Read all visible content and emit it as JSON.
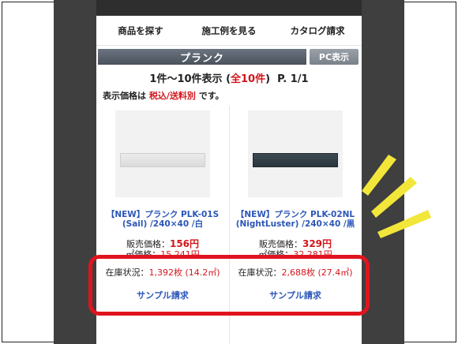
{
  "nav": {
    "items": [
      "商品を探す",
      "施工例を見る",
      "カタログ請求"
    ]
  },
  "category": {
    "title": "プランク",
    "pc_button": "PC表示"
  },
  "results": {
    "range": "1件〜10件表示 (",
    "total": "全10件",
    "close": ")",
    "page": "P. 1/1"
  },
  "price_note": {
    "prefix": "表示価格は ",
    "highlight": "税込/送料別",
    "suffix": " です。"
  },
  "products": [
    {
      "name_line1": "【NEW】プランク PLK-01S",
      "name_line2": "(Sail) /240×40 /白",
      "price_label": "販売価格：",
      "price": "156円",
      "unit_label": "㎡価格：",
      "unit_price": "15,241円",
      "stock_label": "在庫状況：",
      "stock": "1,392枚 (14.2㎡)",
      "sample": "サンプル請求",
      "tile_color": "#e2e2e2"
    },
    {
      "name_line1": "【NEW】プランク PLK-02NL",
      "name_line2": "(NightLuster) /240×40 /黒",
      "price_label": "販売価格：",
      "price": "329円",
      "unit_label": "㎡価格：",
      "unit_price": "32,281円",
      "stock_label": "在庫状況：",
      "stock": "2,688枚 (27.4㎡)",
      "sample": "サンプル請求",
      "tile_color": "#2f3b42"
    }
  ],
  "colors": {
    "accent_red": "#d2161d",
    "link_blue": "#2b56b8",
    "highlight_border": "#e0141e",
    "burst_yellow": "#f2e63a"
  }
}
